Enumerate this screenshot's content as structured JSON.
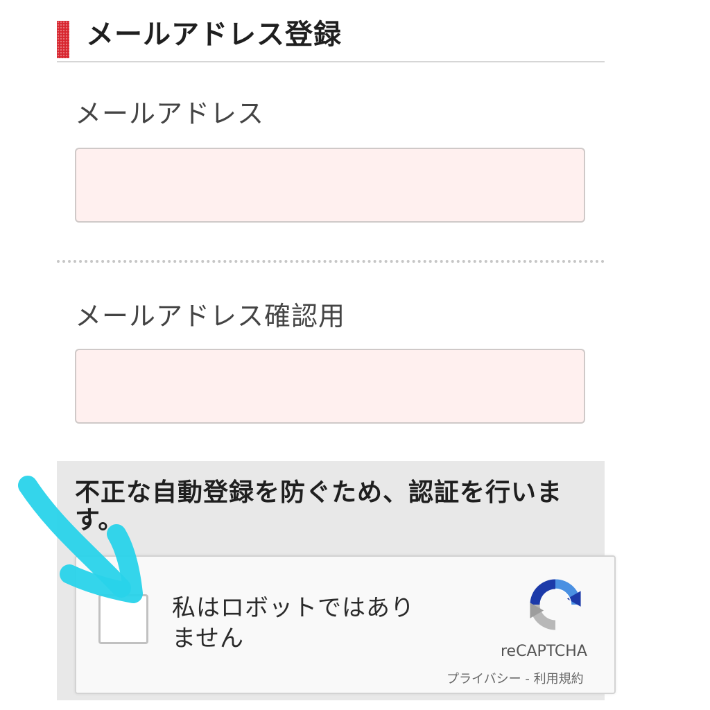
{
  "section": {
    "title": "メールアドレス登録"
  },
  "fields": {
    "email_label": "メールアドレス",
    "email_value": "",
    "confirm_label": "メールアドレス確認用",
    "confirm_value": ""
  },
  "captcha": {
    "notice": "不正な自動登録を防ぐため、認証を行います。",
    "checkbox_label": "私はロボットではありません",
    "checked": false,
    "brand": "reCAPTCHA",
    "terms": "プライバシー - 利用規約"
  },
  "colors": {
    "accent_red": "#d8262f",
    "input_background": "#fff0ef",
    "annotation_cyan": "#29d3ea"
  }
}
